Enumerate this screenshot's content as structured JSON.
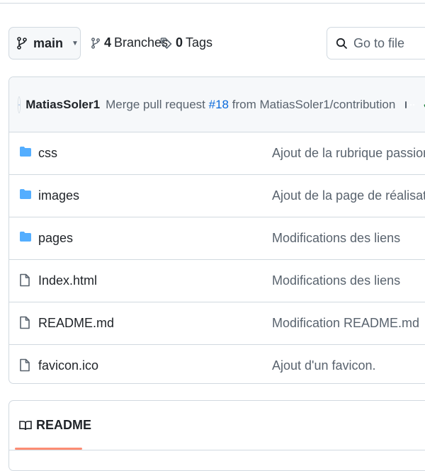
{
  "toolbar": {
    "branch_name": "main",
    "branches_count": "4",
    "branches_label": "Branches",
    "tags_count": "0",
    "tags_label": "Tags",
    "search_placeholder": "Go to file"
  },
  "commit": {
    "author": "MatiasSoler1",
    "message_prefix": "Merge pull request",
    "pr_number": "#18",
    "message_suffix": "from MatiasSoler1/contribution",
    "status": "✓"
  },
  "files": [
    {
      "type": "folder",
      "name": "css",
      "message": "Ajout de la rubrique passion"
    },
    {
      "type": "folder",
      "name": "images",
      "message": "Ajout de la page de réalisation And"
    },
    {
      "type": "folder",
      "name": "pages",
      "message": "Modifications des liens"
    },
    {
      "type": "file",
      "name": "Index.html",
      "message": "Modifications des liens"
    },
    {
      "type": "file",
      "name": "README.md",
      "message": "Modification README.md"
    },
    {
      "type": "file",
      "name": "favicon.ico",
      "message": "Ajout d'un favicon."
    }
  ],
  "readme": {
    "tab_label": "README"
  },
  "colors": {
    "link": "#0969da",
    "folder": "#54aeff",
    "success": "#1a7f37",
    "accent_underline": "#fd8c73"
  }
}
